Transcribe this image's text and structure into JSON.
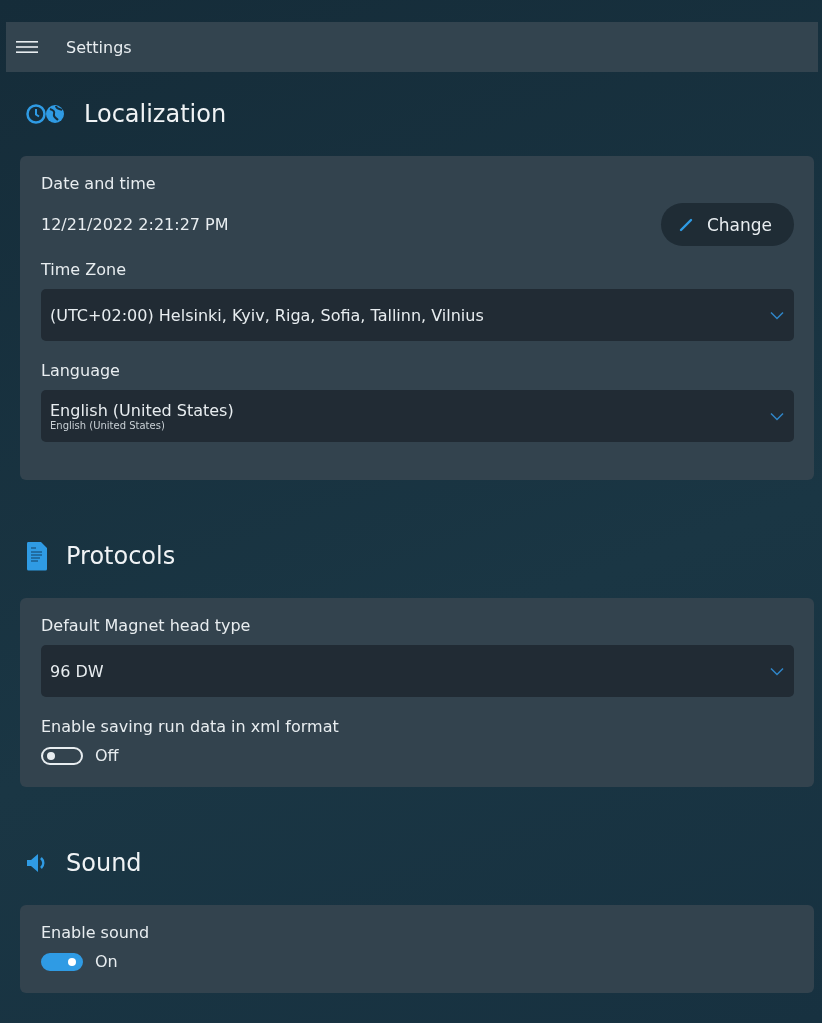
{
  "header": {
    "title": "Settings"
  },
  "sections": [
    {
      "title": "Localization",
      "kind": "clock-globe",
      "items": [
        {
          "kind": "datetime",
          "label": "Date and time",
          "value": "12/21/2022 2:21:27 PM",
          "button": "Change"
        },
        {
          "kind": "dropdown",
          "label": "Time Zone",
          "value": "(UTC+02:00) Helsinki, Kyiv, Riga, Sofia, Tallinn, Vilnius"
        },
        {
          "kind": "dropdown",
          "label": "Language",
          "value": "English (United States)",
          "subvalue": "English (United States)"
        }
      ]
    },
    {
      "title": "Protocols",
      "kind": "document",
      "items": [
        {
          "kind": "dropdown",
          "label": "Default Magnet head type",
          "value": "96 DW"
        },
        {
          "kind": "toggle",
          "label": "Enable saving run data in xml format",
          "on": false,
          "state_text": "Off"
        }
      ]
    },
    {
      "title": "Sound",
      "kind": "speaker",
      "items": [
        {
          "kind": "toggle",
          "label": "Enable sound",
          "on": true,
          "state_text": "On"
        }
      ]
    }
  ]
}
